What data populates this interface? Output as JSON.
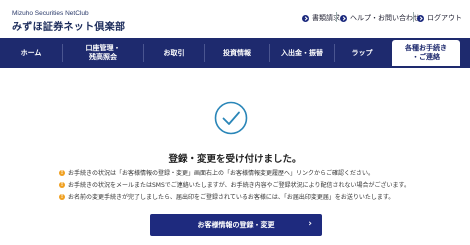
{
  "header": {
    "logo_en": "Mizuho Securities NetClub",
    "logo_ja": "みずほ証券ネット倶楽部",
    "util_links": [
      {
        "label": "書類請求"
      },
      {
        "label": "ヘルプ・お問い合わせ"
      },
      {
        "label": "ログアウト"
      }
    ]
  },
  "nav": {
    "items": [
      {
        "label": "ホーム"
      },
      {
        "label": "口座管理・\n残高照会"
      },
      {
        "label": "お取引"
      },
      {
        "label": "投資情報"
      },
      {
        "label": "入出金・振替"
      },
      {
        "label": "ラップ"
      },
      {
        "label": "各種お手続き\n・ご連絡",
        "active": true
      }
    ]
  },
  "main": {
    "title": "登録・変更を受け付けました。",
    "notes": [
      "お手続きの状況は「お客様情報の登録・変更」画面右上の「お客様情報変更履歴へ」リンクからご確認ください。",
      "お手続きの状況をメールまたはSMSでご連絡いたしますが、お手続き内容やご登録状況により配信されない場合がございます。",
      "お名前の変更手続きが完了しましたら、届出印をご登録されているお客様には、「お届出印変更届」をお送りいたします。"
    ],
    "button_label": "お客様情報の登録・変更"
  },
  "colors": {
    "navy": "#1e2a6e",
    "accent_teal": "#2a86b8",
    "note_icon": "#f0a020"
  }
}
